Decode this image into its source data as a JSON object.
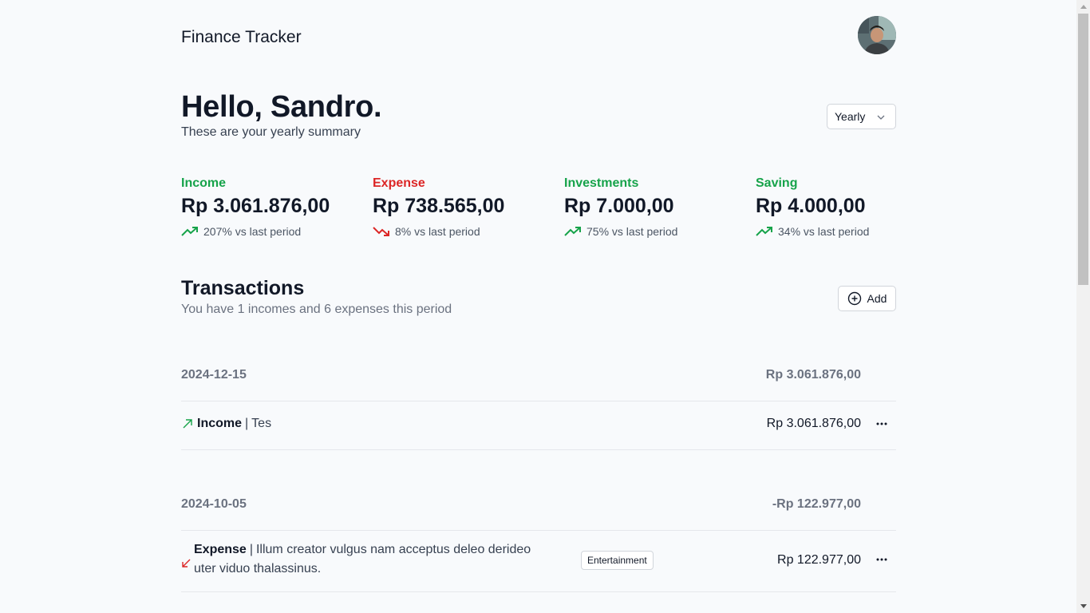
{
  "header": {
    "title": "Finance Tracker"
  },
  "greeting": {
    "title": "Hello, Sandro.",
    "subtitle": "These are your yearly summary"
  },
  "period_select": {
    "value": "Yearly"
  },
  "stats": [
    {
      "label": "Income",
      "value": "Rp 3.061.876,00",
      "change": "207% vs last period",
      "trend": "up",
      "color": "#16a34a"
    },
    {
      "label": "Expense",
      "value": "Rp 738.565,00",
      "change": "8% vs last period",
      "trend": "down",
      "color": "#dc2626"
    },
    {
      "label": "Investments",
      "value": "Rp 7.000,00",
      "change": "75% vs last period",
      "trend": "up",
      "color": "#16a34a"
    },
    {
      "label": "Saving",
      "value": "Rp 4.000,00",
      "change": "34% vs last period",
      "trend": "up",
      "color": "#16a34a"
    }
  ],
  "transactions": {
    "title": "Transactions",
    "subtitle": "You have 1 incomes and 6 expenses this period",
    "add_label": "Add",
    "groups": [
      {
        "date": "2024-12-15",
        "total": "Rp 3.061.876,00",
        "items": [
          {
            "kind": "Income",
            "separator": "|",
            "description": "Tes",
            "category": "",
            "amount": "Rp 3.061.876,00"
          }
        ]
      },
      {
        "date": "2024-10-05",
        "total": "-Rp 122.977,00",
        "items": [
          {
            "kind": "Expense",
            "separator": "|",
            "description": "Illum creator vulgus nam acceptus deleo derideo uter viduo thalassinus.",
            "category": "Entertainment",
            "amount": "Rp 122.977,00"
          }
        ]
      }
    ]
  }
}
